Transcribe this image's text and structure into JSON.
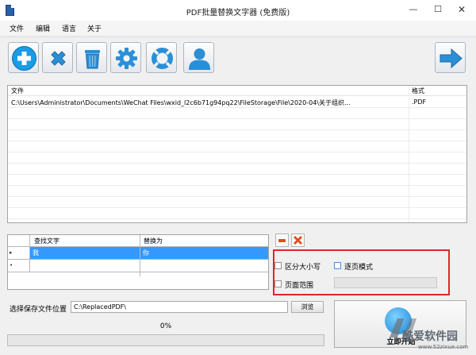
{
  "window": {
    "title": "PDF批量替换文字器 (免费版)",
    "min": "—",
    "max": "☐",
    "close": "✕"
  },
  "menu": [
    "文件",
    "编辑",
    "语言",
    "关于"
  ],
  "toolbar": [
    {
      "name": "add-icon",
      "color": "#1a9be6"
    },
    {
      "name": "delete-icon",
      "color": "#2a8fd6"
    },
    {
      "name": "trash-icon",
      "color": "#2a8fd6"
    },
    {
      "name": "gear-icon",
      "color": "#2a8fd6"
    },
    {
      "name": "lifebuoy-icon",
      "color": "#2a8fd6"
    },
    {
      "name": "user-icon",
      "color": "#2a8fd6"
    },
    {
      "name": "arrow-right-icon",
      "color": "#2a8fd6"
    }
  ],
  "file_table": {
    "headers": [
      "文件",
      "格式"
    ],
    "rows": [
      [
        "C:\\Users\\Administrator\\Documents\\WeChat Files\\wxid_l2c6b71g94pq22\\FileStorage\\File\\2020-04\\关于组织...",
        ".PDF"
      ]
    ]
  },
  "replace_table": {
    "headers": [
      "查找文字",
      "替换为"
    ],
    "rows": [
      [
        "我",
        "你"
      ]
    ],
    "current_marker": "▸",
    "new_marker": "•"
  },
  "options": {
    "case_sensitive": "区分大小写",
    "page_mode": "逐页模式",
    "page_range": "页面范围",
    "page_range_value": ""
  },
  "save": {
    "label": "选择保存文件位置",
    "path": "C:\\ReplacedPDF\\",
    "browse": "浏览"
  },
  "progress": {
    "text": "0%",
    "value": 0
  },
  "start": {
    "label": "立即开始"
  },
  "watermark": {
    "brand": "酷爱软件园",
    "url": "www.52zixue.com"
  },
  "colors": {
    "accent": "#2a8fd6",
    "selection": "#3399ff",
    "highlight_box": "#e0262c",
    "remove": "#e04e1a"
  }
}
